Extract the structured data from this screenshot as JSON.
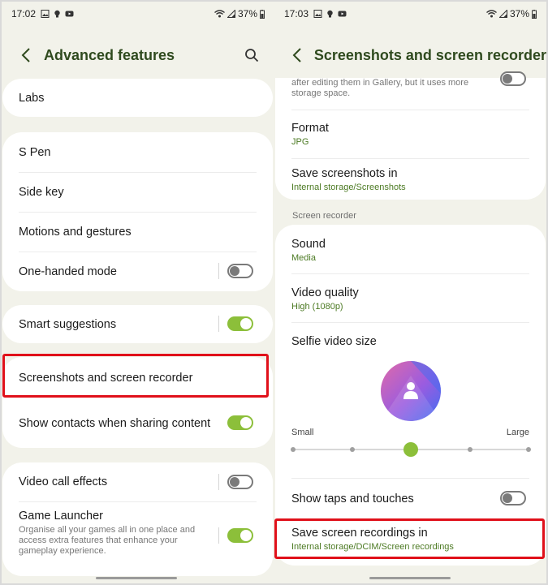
{
  "left": {
    "status": {
      "time": "17:02",
      "battery": "37%"
    },
    "title": "Advanced features",
    "items": {
      "labs": "Labs",
      "s_pen": "S Pen",
      "side_key": "Side key",
      "motions": "Motions and gestures",
      "one_handed": "One-handed mode",
      "smart_suggestions": "Smart suggestions",
      "screenshots": "Screenshots and screen recorder",
      "show_contacts": "Show contacts when sharing content",
      "video_call": "Video call effects",
      "game_launcher": "Game Launcher",
      "game_launcher_desc": "Organise all your games all in one place and access extra features that enhance your gameplay experience."
    },
    "toggles": {
      "one_handed": false,
      "smart_suggestions": true,
      "show_contacts": true,
      "video_call": false,
      "game_launcher": true
    }
  },
  "right": {
    "status": {
      "time": "17:03",
      "battery": "37%"
    },
    "title": "Screenshots and screen recorder",
    "partial_desc": "after editing them in Gallery, but it uses more storage space.",
    "format": {
      "label": "Format",
      "value": "JPG"
    },
    "save_screenshots": {
      "label": "Save screenshots in",
      "value": "Internal storage/Screenshots"
    },
    "section_header": "Screen recorder",
    "sound": {
      "label": "Sound",
      "value": "Media"
    },
    "video_quality": {
      "label": "Video quality",
      "value": "High (1080p)"
    },
    "selfie_video_size": {
      "label": "Selfie video size",
      "min_label": "Small",
      "max_label": "Large",
      "level": 2,
      "steps": 5
    },
    "show_taps": {
      "label": "Show taps and touches",
      "on": false
    },
    "save_recordings": {
      "label": "Save screen recordings in",
      "value": "Internal storage/DCIM/Screen recordings"
    }
  },
  "colors": {
    "accent_green": "#8cbf3a",
    "value_green": "#4c7a23",
    "title_green": "#2f4a1e",
    "highlight_red": "#e0101a"
  },
  "icons": [
    "back-icon",
    "search-icon",
    "wifi-icon",
    "signal-icon",
    "battery-icon",
    "gallery-icon",
    "bulb-icon",
    "youtube-icon",
    "person-icon"
  ]
}
